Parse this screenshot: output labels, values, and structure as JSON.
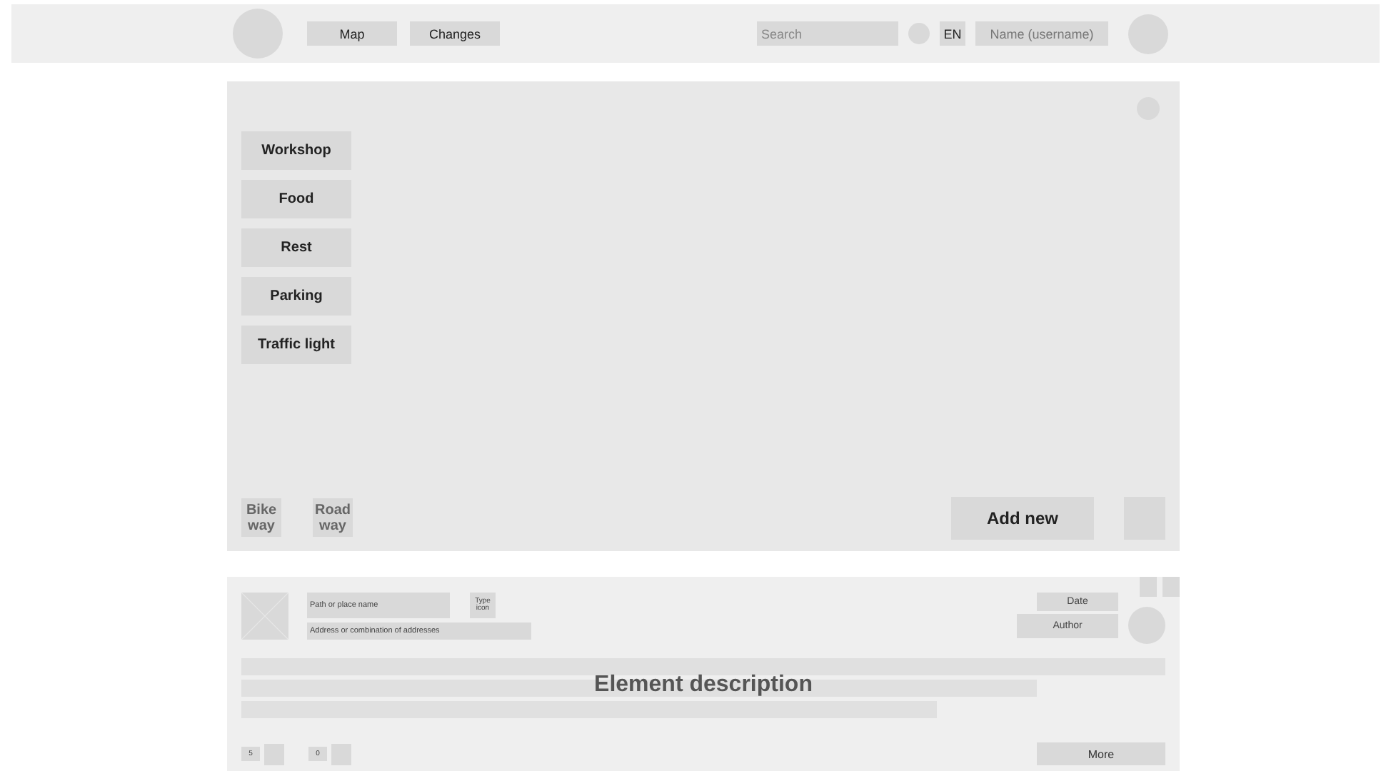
{
  "top_bar": {
    "nav": [
      "Map",
      "Changes"
    ],
    "search": {
      "placeholder": "Search"
    },
    "language": "EN",
    "user": "Name (username)"
  },
  "map": {
    "categories": [
      "Workshop",
      "Food",
      "Rest",
      "Parking",
      "Traffic light"
    ],
    "layers": [
      "Bike way",
      "Road way"
    ],
    "add_button": "Add new"
  },
  "element_card": {
    "name_field": "Path or place name",
    "type_icon": "Type icon",
    "address_field": "Address or combination of addresses",
    "date": "Date",
    "author": "Author",
    "description": "Element description",
    "counts": [
      "5",
      "0"
    ],
    "more_button": "More"
  }
}
